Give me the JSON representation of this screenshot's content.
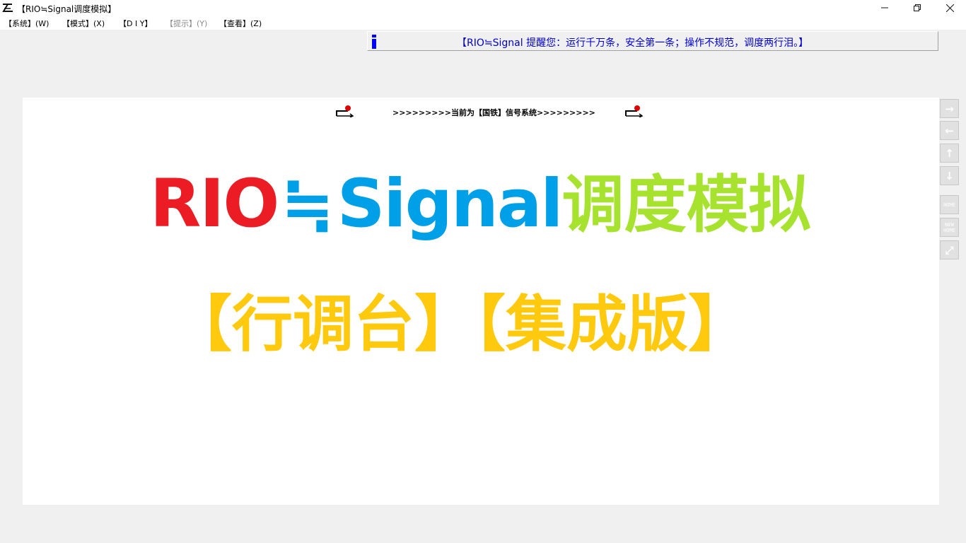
{
  "window": {
    "title": "【RIO≒Signal调度模拟】",
    "app_icon": "app-logo-icon",
    "controls": {
      "minimize": "minimize-icon",
      "restore": "restore-icon",
      "close": "close-icon"
    }
  },
  "menu": [
    {
      "label": "【系统】(W)",
      "enabled": true
    },
    {
      "label": "【模式】(X)",
      "enabled": true
    },
    {
      "label": "【D I Y】",
      "enabled": true
    },
    {
      "label": "【提示】(Y)",
      "enabled": false
    },
    {
      "label": "【查看】(Z)",
      "enabled": true
    }
  ],
  "notice": {
    "icon": "info-icon",
    "text": "【RIO≒Signal 提醒您：运行千万条，安全第一条；操作不规范，调度两行泪。】",
    "color": "#0000cc"
  },
  "canvas": {
    "system_banner": ">>>>>>>>>当前为【国铁】信号系统>>>>>>>>>",
    "signal_icon": "signal-icon",
    "logo": {
      "rio": "RIO",
      "approx": "≒",
      "signal": "Signal",
      "cn": "调度模拟",
      "colors": {
        "rio": "#ec1c24",
        "signal": "#00a0e9",
        "cn": "#a6e22e"
      }
    },
    "subtitle": "【行调台】【集成版】",
    "subtitle_color": "#ffc90e"
  },
  "side_tools": [
    {
      "name": "scroll-right-button",
      "icon": "arrow-right-icon",
      "glyph": "→"
    },
    {
      "name": "scroll-left-button",
      "icon": "arrow-left-icon",
      "glyph": "←"
    },
    {
      "name": "scroll-up-button",
      "icon": "arrow-up-icon",
      "glyph": "↑"
    },
    {
      "name": "scroll-down-button",
      "icon": "arrow-down-icon",
      "glyph": "↓"
    },
    {
      "name": "home-button",
      "icon": "home-icon",
      "glyph": "HOME"
    },
    {
      "name": "new-home-button",
      "icon": "new-home-icon",
      "glyph": "NEW HOME"
    },
    {
      "name": "fullscreen-button",
      "icon": "fullscreen-icon",
      "glyph": "⤢"
    }
  ]
}
